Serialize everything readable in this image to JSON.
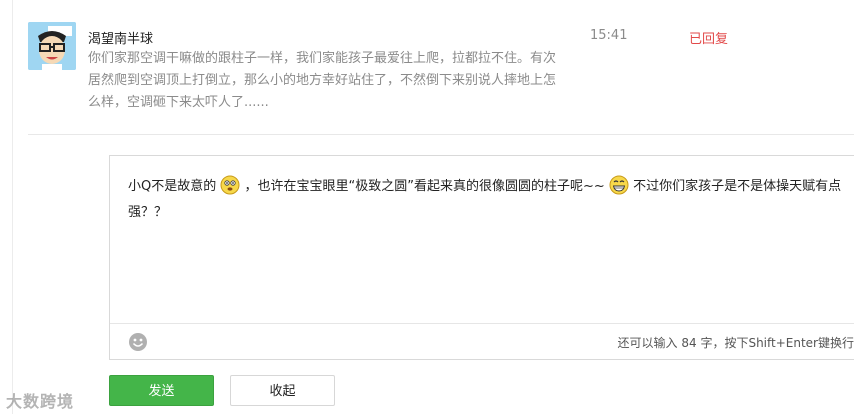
{
  "message": {
    "username": "渴望南半球",
    "text": "你们家那空调干嘛做的跟柱子一样，我们家能孩子最爱往上爬，拉都拉不住。有次居然爬到空调顶上打倒立，那么小的地方幸好站住了，不然倒下来别说人摔地上怎么样，空调砸下来太吓人了......",
    "time": "15:41",
    "status": "已回复",
    "status_color": "#e24a4a"
  },
  "reply": {
    "part1": "小Q不是故意的",
    "part2": "，也许在宝宝眼里“极致之圆”看起来真的很像圆圆的柱子呢~~",
    "part3": " 不过你们家孩子是不是体操天赋有点强？？",
    "emoji1": "emoji-face-icon",
    "emoji2": "grin-emoji-icon"
  },
  "toolbar": {
    "emoji_button": "smiley-icon",
    "counter_text": "还可以输入 84 字，按下Shift+Enter键换行"
  },
  "buttons": {
    "send_label": "发送",
    "collapse_label": "收起",
    "send_color": "#44b549"
  },
  "watermark": "大数跨境"
}
